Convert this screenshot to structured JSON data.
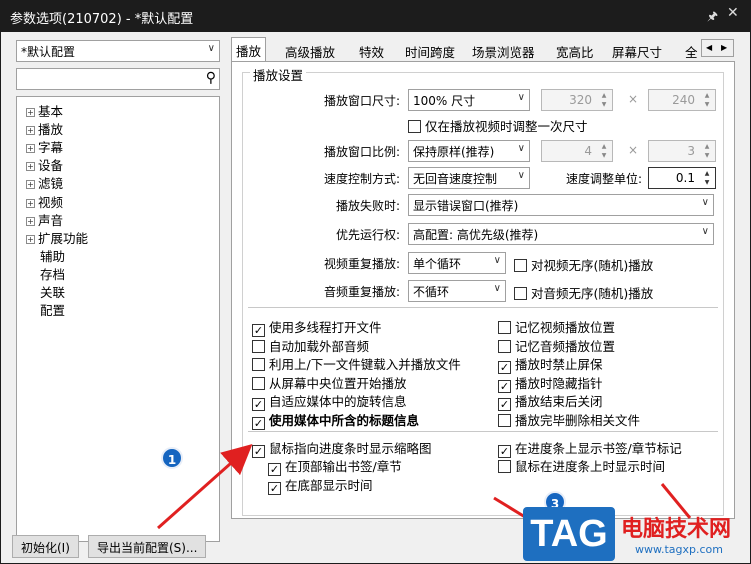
{
  "window": {
    "title": "参数选项(210702) - *默认配置",
    "pin_icon": "pin-icon",
    "close_icon": "close-icon"
  },
  "profile_select": "*默认配置",
  "search": {
    "placeholder": "",
    "value": ""
  },
  "tree": [
    {
      "label": "基本",
      "expandable": true
    },
    {
      "label": "播放",
      "expandable": true
    },
    {
      "label": "字幕",
      "expandable": true
    },
    {
      "label": "设备",
      "expandable": true
    },
    {
      "label": "滤镜",
      "expandable": true
    },
    {
      "label": "视频",
      "expandable": true
    },
    {
      "label": "声音",
      "expandable": true
    },
    {
      "label": "扩展功能",
      "expandable": true
    },
    {
      "label": "辅助",
      "expandable": false
    },
    {
      "label": "存档",
      "expandable": false
    },
    {
      "label": "关联",
      "expandable": false
    },
    {
      "label": "配置",
      "expandable": false
    }
  ],
  "tabs": [
    "播放",
    "高级播放",
    "特效",
    "时间跨度",
    "场景浏览器",
    "宽高比",
    "屏幕尺寸",
    "全"
  ],
  "active_tab": "播放",
  "group_title": "播放设置",
  "settings": {
    "window_size_label": "播放窗口尺寸:",
    "window_size_value": "100% 尺寸",
    "width": "320",
    "height": "240",
    "times_sign": "×",
    "adjust_once": "仅在播放视频时调整一次尺寸",
    "aspect_label": "播放窗口比例:",
    "aspect_value": "保持原样(推荐)",
    "aspect_w": "4",
    "aspect_h": "3",
    "speed_mode_label": "速度控制方式:",
    "speed_mode_value": "无回音速度控制",
    "speed_unit_label": "速度调整单位:",
    "speed_unit_value": "0.1",
    "on_fail_label": "播放失败时:",
    "on_fail_value": "显示错误窗口(推荐)",
    "priority_label": "优先运行权:",
    "priority_value": "高配置: 高优先级(推荐)",
    "video_repeat_label": "视频重复播放:",
    "video_repeat_value": "单个循环",
    "video_random": "对视频无序(随机)播放",
    "audio_repeat_label": "音频重复播放:",
    "audio_repeat_value": "不循环",
    "audio_random": "对音频无序(随机)播放"
  },
  "options_left": [
    {
      "label": "使用多线程打开文件",
      "checked": true
    },
    {
      "label": "自动加载外部音频",
      "checked": false
    },
    {
      "label": "利用上/下一文件键载入并播放文件",
      "checked": false
    },
    {
      "label": "从屏幕中央位置开始播放",
      "checked": false
    },
    {
      "label": "自适应媒体中的旋转信息",
      "checked": true
    },
    {
      "label": "使用媒体中所含的标题信息",
      "checked": true
    }
  ],
  "options_right": [
    {
      "label": "记忆视频播放位置",
      "checked": false
    },
    {
      "label": "记忆音频播放位置",
      "checked": false
    },
    {
      "label": "播放时禁止屏保",
      "checked": true
    },
    {
      "label": "播放时隐藏指针",
      "checked": true
    },
    {
      "label": "播放结束后关闭",
      "checked": true
    },
    {
      "label": "播放完毕删除相关文件",
      "checked": false
    }
  ],
  "thumb_options": {
    "thumbnail": {
      "label": "鼠标指向进度条时显示缩略图",
      "checked": true
    },
    "top_chapter": {
      "label": "在顶部输出书签/章节",
      "checked": true
    },
    "bottom_time": {
      "label": "在底部显示时间",
      "checked": true
    },
    "show_marks": {
      "label": "在进度条上显示书签/章节标记",
      "checked": true
    },
    "hover_time": {
      "label": "鼠标在进度条上时显示时间",
      "checked": false
    }
  },
  "buttons": {
    "init": "初始化(I)",
    "export": "导出当前配置(S)..."
  },
  "markers": [
    "1",
    "3"
  ],
  "watermark": {
    "tag": "TAG",
    "site_name": "电脑技术网",
    "url": "www.tagxp.com"
  },
  "colors": {
    "arrow": "#e02020",
    "marker": "#1565c0",
    "watermark_blue": "#1e6fc0",
    "watermark_red": "#e02020"
  }
}
